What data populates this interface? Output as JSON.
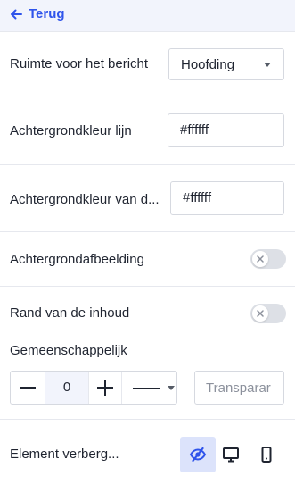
{
  "header": {
    "back_label": "Terug"
  },
  "fields": {
    "ruimte": {
      "label": "Ruimte voor het bericht",
      "value": "Hoofding"
    },
    "bg_lijn": {
      "label": "Achtergrondkleur lijn",
      "value": "#ffffff"
    },
    "bg_van": {
      "label": "Achtergrondkleur van d...",
      "value": "#ffffff"
    },
    "bg_afbeelding": {
      "label": "Achtergrondafbeelding",
      "enabled": false
    },
    "rand": {
      "label": "Rand van de inhoud",
      "enabled": false
    },
    "gemeenschappelijk": {
      "label": "Gemeenschappelijk",
      "width": "0",
      "transparency_label": "Transparar"
    },
    "verberg": {
      "label": "Element verberg...",
      "selected": "hidden"
    }
  },
  "colors": {
    "accent": "#2f54eb",
    "active_bg": "#dce3fb",
    "header_bg": "#f2f4fc"
  }
}
